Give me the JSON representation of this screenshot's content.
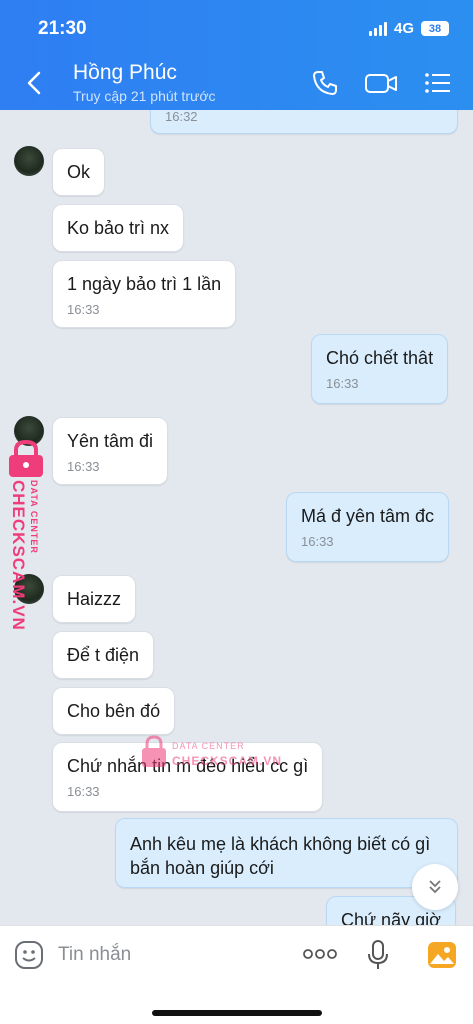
{
  "status_bar": {
    "time": "21:30",
    "network": "4G",
    "battery": "38"
  },
  "header": {
    "name": "Hồng Phúc",
    "status": "Truy cập 21 phút trước",
    "icons": [
      "back-icon",
      "phone-icon",
      "video-call-icon",
      "menu-list-icon"
    ]
  },
  "messages": [
    {
      "from": "me",
      "text": "",
      "time": "16:32"
    },
    {
      "from": "them",
      "text": "Ok",
      "time": ""
    },
    {
      "from": "them",
      "text": "Ko bảo trì nx",
      "time": ""
    },
    {
      "from": "them",
      "text": "1 ngày bảo trì 1 lần",
      "time": "16:33"
    },
    {
      "from": "me",
      "text": "Chó chết thât",
      "time": "16:33"
    },
    {
      "from": "them",
      "text": "Yên tâm đi",
      "time": "16:33"
    },
    {
      "from": "me",
      "text": "Má đ yên tâm đc",
      "time": "16:33"
    },
    {
      "from": "them",
      "text": "Haizzz",
      "time": ""
    },
    {
      "from": "them",
      "text": "Để t điện",
      "time": ""
    },
    {
      "from": "them",
      "text": "Cho bên đó",
      "time": ""
    },
    {
      "from": "them",
      "text": "Chứ nhắn tin m đéo hiểu cc gì",
      "time": "16:33"
    },
    {
      "from": "me",
      "text": "Anh kêu mẹ là khách không biết có gì",
      "text2": "bắn hoàn giúp cới",
      "time": ""
    },
    {
      "from": "me",
      "text": "Chứ nãy giờ",
      "time": ""
    }
  ],
  "watermark": {
    "brand": "CHECKSCAM.VN",
    "sub": "DATA CENTER"
  },
  "input": {
    "placeholder": "Tin nhắn"
  },
  "colors": {
    "header": "#2f7ef2",
    "my_bubble": "#d9edfd",
    "background": "#e3e8ef",
    "watermark": "#ef3c7a"
  }
}
